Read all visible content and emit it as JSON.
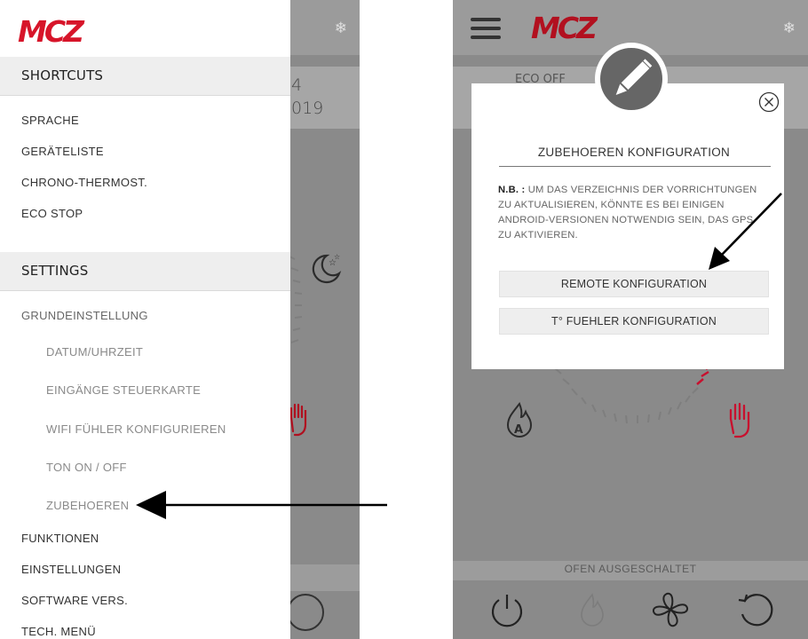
{
  "brand": {
    "logo_text": "MCZ",
    "logo_color": "#d7152a"
  },
  "left_screen": {
    "background_fragments": {
      "line1": "4",
      "line2": "019"
    },
    "drawer": {
      "shortcuts_header": "SHORTCUTS",
      "shortcuts": [
        {
          "label": "SPRACHE"
        },
        {
          "label": "GERÄTELISTE"
        },
        {
          "label": "CHRONO-THERMOST."
        },
        {
          "label": "ECO STOP"
        }
      ],
      "settings_header": "SETTINGS",
      "settings": [
        {
          "label": "GRUNDEINSTELLUNG"
        },
        {
          "label": "DATUM/UHRZEIT"
        },
        {
          "label": "EINGÄNGE STEUERKARTE"
        },
        {
          "label": "WIFI FÜHLER KONFIGURIEREN"
        },
        {
          "label": "TON ON / OFF"
        },
        {
          "label": "ZUBEHOEREN"
        },
        {
          "label": "FUNKTIONEN"
        },
        {
          "label": "EINSTELLUNGEN"
        },
        {
          "label": "SOFTWARE VERS."
        },
        {
          "label": "TECH. MENÜ"
        }
      ]
    }
  },
  "right_screen": {
    "background_fragments": {
      "eco": "ECO OFF"
    },
    "status": "OFEN AUSGESCHALTET",
    "modal": {
      "title": "ZUBEHOEREN KONFIGURATION",
      "note_label": "N.B. :",
      "note_text": "UM DAS VERZEICHNIS DER VORRICHTUNGEN ZU AKTUALISIEREN, KÖNNTE ES BEI EINIGEN ANDROID-VERSIONEN NOTWENDIG SEIN, DAS GPS ZU AKTIVIEREN.",
      "buttons": [
        {
          "label": "REMOTE KONFIGURATION"
        },
        {
          "label": "T° FUEHLER KONFIGURATION"
        }
      ]
    }
  },
  "colors": {
    "accent_red": "#c8102e",
    "dim_background": "#8a8a8a"
  }
}
